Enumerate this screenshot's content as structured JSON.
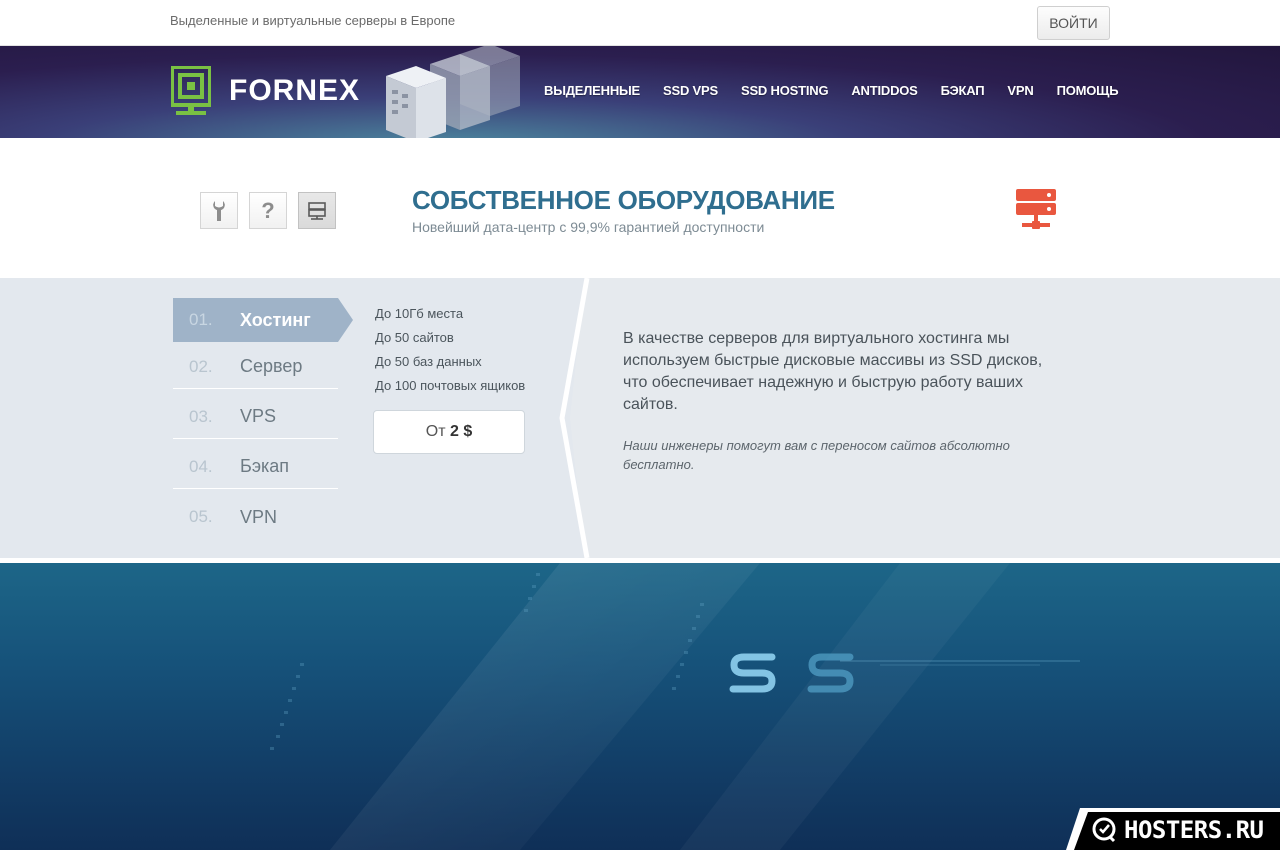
{
  "topbar": {
    "tagline": "Выделенные и виртуальные серверы в Европе",
    "login_label": "ВОЙТИ"
  },
  "header": {
    "logo_text": "FORNEX",
    "nav": [
      "ВЫДЕЛЕННЫЕ",
      "SSD VPS",
      "SSD HOSTING",
      "ANTIDDOS",
      "БЭКАП",
      "VPN",
      "ПОМОЩЬ"
    ]
  },
  "feature": {
    "icons": [
      "wrench-icon",
      "question-icon",
      "server-icon"
    ],
    "title": "СОБСТВЕННОЕ ОБОРУДОВАНИЕ",
    "subtitle": "Новейший дата-центр с 99,9% гарантией доступности",
    "accent_color": "#e9573f"
  },
  "plans": {
    "tabs": [
      {
        "num": "01.",
        "label": "Хостинг",
        "active": true
      },
      {
        "num": "02.",
        "label": "Сервер",
        "active": false
      },
      {
        "num": "03.",
        "label": "VPS",
        "active": false
      },
      {
        "num": "04.",
        "label": "Бэкап",
        "active": false
      },
      {
        "num": "05.",
        "label": "VPN",
        "active": false
      }
    ],
    "specs": [
      "До 10Гб места",
      "До 50 сайтов",
      "До 50 баз данных",
      "До 100 почтовых ящиков"
    ],
    "price_prefix": "От",
    "price_value": "2 $",
    "description": "В качестве серверов для виртуального хостинга мы используем быстрые дисковые массивы из SSD дисков, что обеспечивает надежную и быструю работу ваших сайтов.",
    "note": "Наши инженеры помогут вам с переносом сайтов абсолютно бесплатно."
  },
  "watermark": {
    "text": "HOSTERS.RU"
  }
}
